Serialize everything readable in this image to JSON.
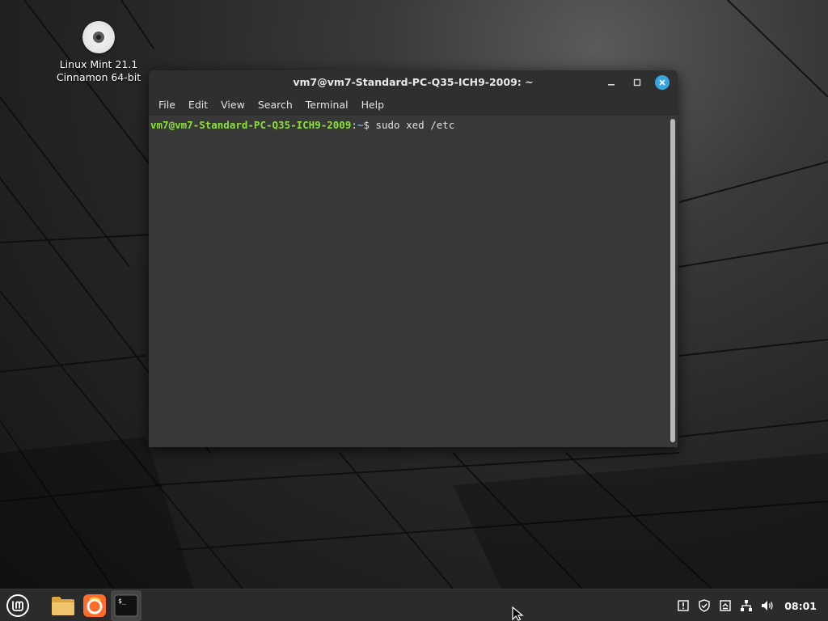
{
  "desktop": {
    "icons": [
      {
        "line1": "Linux Mint 21.1",
        "line2": "Cinnamon 64-bit",
        "icon": "disc-icon"
      }
    ]
  },
  "terminal": {
    "title": "vm7@vm7-Standard-PC-Q35-ICH9-2009: ~",
    "menu": [
      "File",
      "Edit",
      "View",
      "Search",
      "Terminal",
      "Help"
    ],
    "prompt_user": "vm7@vm7-Standard-PC-Q35-ICH9-2009",
    "prompt_sep": ":",
    "prompt_path": "~",
    "prompt_symbol": "$ ",
    "command": "sudo xed /etc",
    "colors": {
      "prompt_user": "#8ae234",
      "prompt_path": "#7fa5d9",
      "close_button": "#35a6e0"
    }
  },
  "panel": {
    "menu_icon": "mint-logo-icon",
    "launchers": [
      {
        "name": "files",
        "icon": "folder-icon",
        "active": false
      },
      {
        "name": "firefox",
        "icon": "firefox-icon",
        "active": false
      },
      {
        "name": "terminal",
        "icon": "terminal-icon",
        "active": true,
        "glyph": "$_"
      }
    ],
    "tray": [
      "info-icon",
      "shield-icon",
      "update-icon",
      "network-icon",
      "volume-icon"
    ],
    "clock": "08:01"
  }
}
